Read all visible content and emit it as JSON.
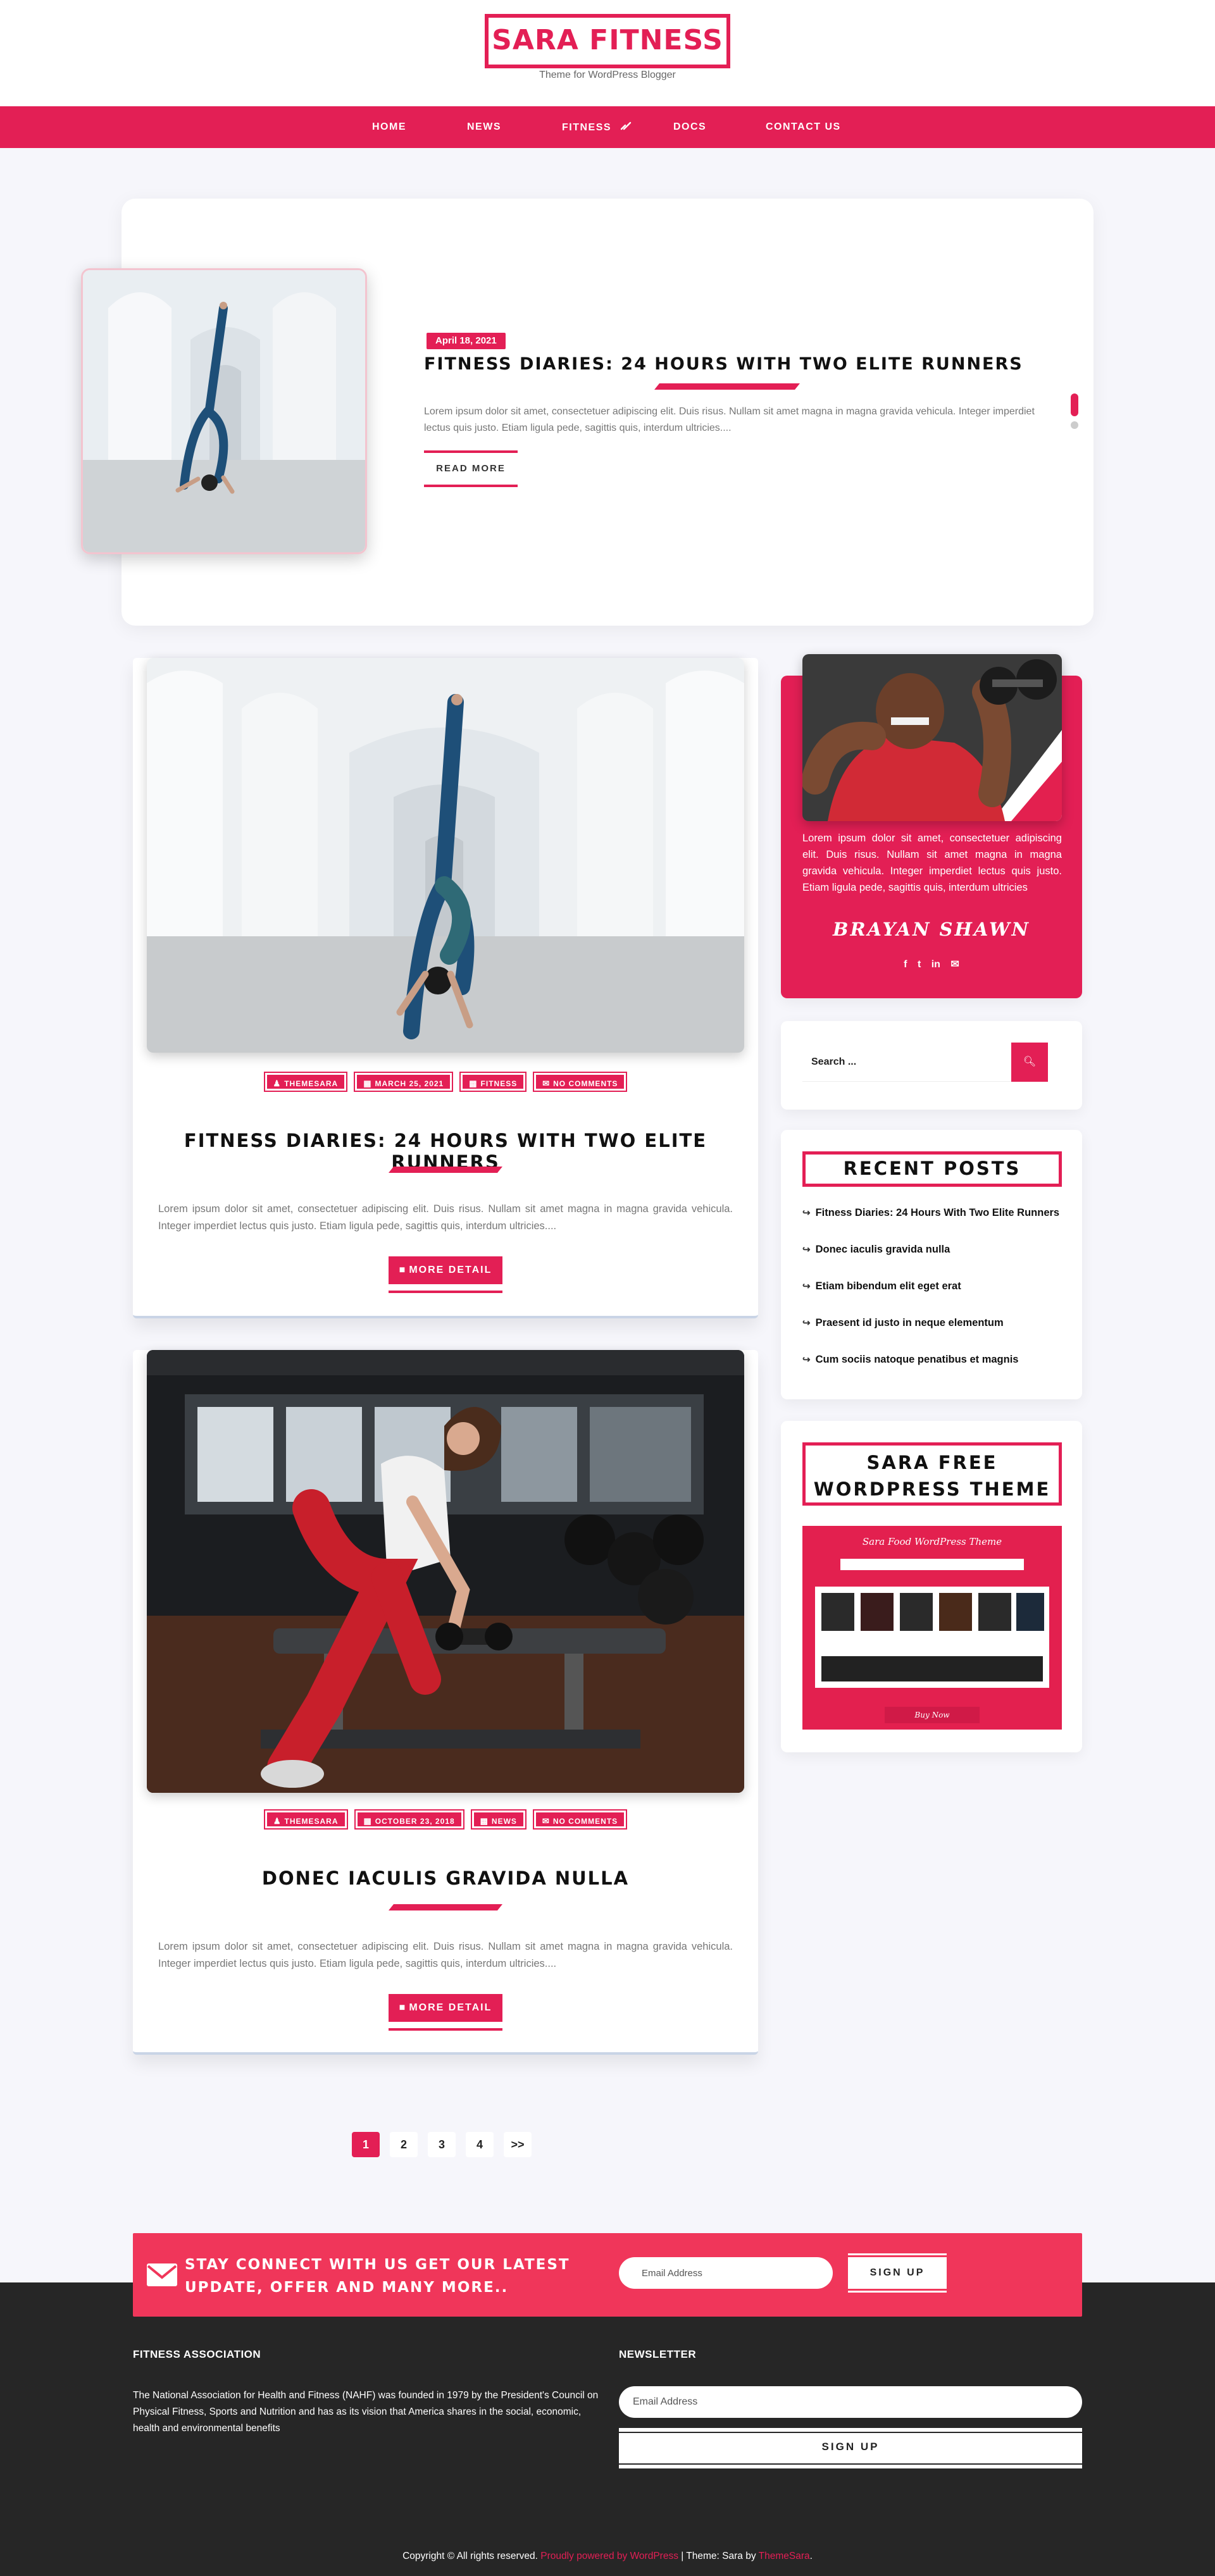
{
  "site": {
    "logo": "SARA FITNESS",
    "tagline": "Theme for WordPress Blogger",
    "accent_color": "#e31f55"
  },
  "nav": {
    "items": [
      {
        "label": "HOME"
      },
      {
        "label": "NEWS"
      },
      {
        "label": "FITNESS",
        "has_dropdown": true,
        "icon": "chevron-down-icon"
      },
      {
        "label": "DOCS"
      },
      {
        "label": "CONTACT US"
      }
    ]
  },
  "slider": {
    "date": "April 18, 2021",
    "title": "FITNESS DIARIES: 24 HOURS WITH TWO ELITE RUNNERS",
    "excerpt": "Lorem ipsum dolor sit amet, consectetuer adipiscing elit. Duis risus. Nullam sit amet magna in magna gravida vehicula. Integer imperdiet lectus quis justo. Etiam ligula pede, sagittis quis, interdum ultricies....",
    "read_more": "READ MORE"
  },
  "posts": [
    {
      "author": "THEMESARA",
      "date": "MARCH 25, 2021",
      "category": "FITNESS",
      "comments": "NO COMMENTS",
      "title": "FITNESS DIARIES: 24 HOURS WITH TWO ELITE RUNNERS",
      "excerpt": "Lorem ipsum dolor sit amet, consectetuer adipiscing elit. Duis risus. Nullam sit amet magna in magna gravida vehicula. Integer imperdiet lectus quis justo. Etiam ligula pede, sagittis quis, interdum ultricies....",
      "button": "MORE DETAIL"
    },
    {
      "author": "THEMESARA",
      "date": "OCTOBER 23, 2018",
      "category": "NEWS",
      "comments": "NO COMMENTS",
      "title": "DONEC IACULIS GRAVIDA NULLA",
      "excerpt": "Lorem ipsum dolor sit amet, consectetuer adipiscing elit. Duis risus. Nullam sit amet magna in magna gravida vehicula. Integer imperdiet lectus quis justo. Etiam ligula pede, sagittis quis, interdum ultricies....",
      "button": "MORE DETAIL"
    }
  ],
  "pagination": {
    "pages": [
      "1",
      "2",
      "3",
      "4",
      ">>"
    ],
    "current": "1"
  },
  "sidebar": {
    "author": {
      "bio": "Lorem ipsum dolor sit amet, consectetuer adipiscing elit. Duis risus. Nullam sit amet magna in magna gravida vehicula. Integer imperdiet lectus quis justo. Etiam ligula pede, sagittis quis, interdum ultricies",
      "name": "BRAYAN SHAWN",
      "social": [
        "f",
        "t",
        "in",
        "✉"
      ]
    },
    "search": {
      "placeholder": "Search ..."
    },
    "recent_posts": {
      "title": "RECENT POSTS",
      "items": [
        "Fitness Diaries: 24 Hours With Two Elite Runners",
        "Donec iaculis gravida nulla",
        "Etiam bibendum elit eget erat",
        "Praesent id justo in neque elementum",
        "Cum sociis natoque penatibus et magnis"
      ]
    },
    "promo": {
      "title_line1": "SARA FREE",
      "title_line2": "WORDPRESS THEME",
      "banner_text": "Sara Food WordPress Theme",
      "banner_button": "Buy Now"
    }
  },
  "newsletter_band": {
    "line1": "STAY CONNECT WITH US GET OUR LATEST",
    "line2": "UPDATE, OFFER AND MANY MORE..",
    "placeholder": "Email Address",
    "button": "SIGN UP"
  },
  "footer": {
    "about_title": "FITNESS ASSOCIATION",
    "about_text": "The National Association for Health and Fitness (NAHF) was founded in 1979 by the President's Council on Physical Fitness, Sports and Nutrition and has as its vision that America shares in the social, economic, health and environmental benefits",
    "newsletter_title": "NEWSLETTER",
    "newsletter_placeholder": "Email Address",
    "newsletter_button": "SIGN UP",
    "copyright_prefix": "Copyright © All rights reserved.",
    "copyright_wp": "Proudly powered by WordPress",
    "copyright_theme": " | Theme: Sara by ",
    "copyright_author": "ThemeSara",
    "copyright_end": "."
  }
}
